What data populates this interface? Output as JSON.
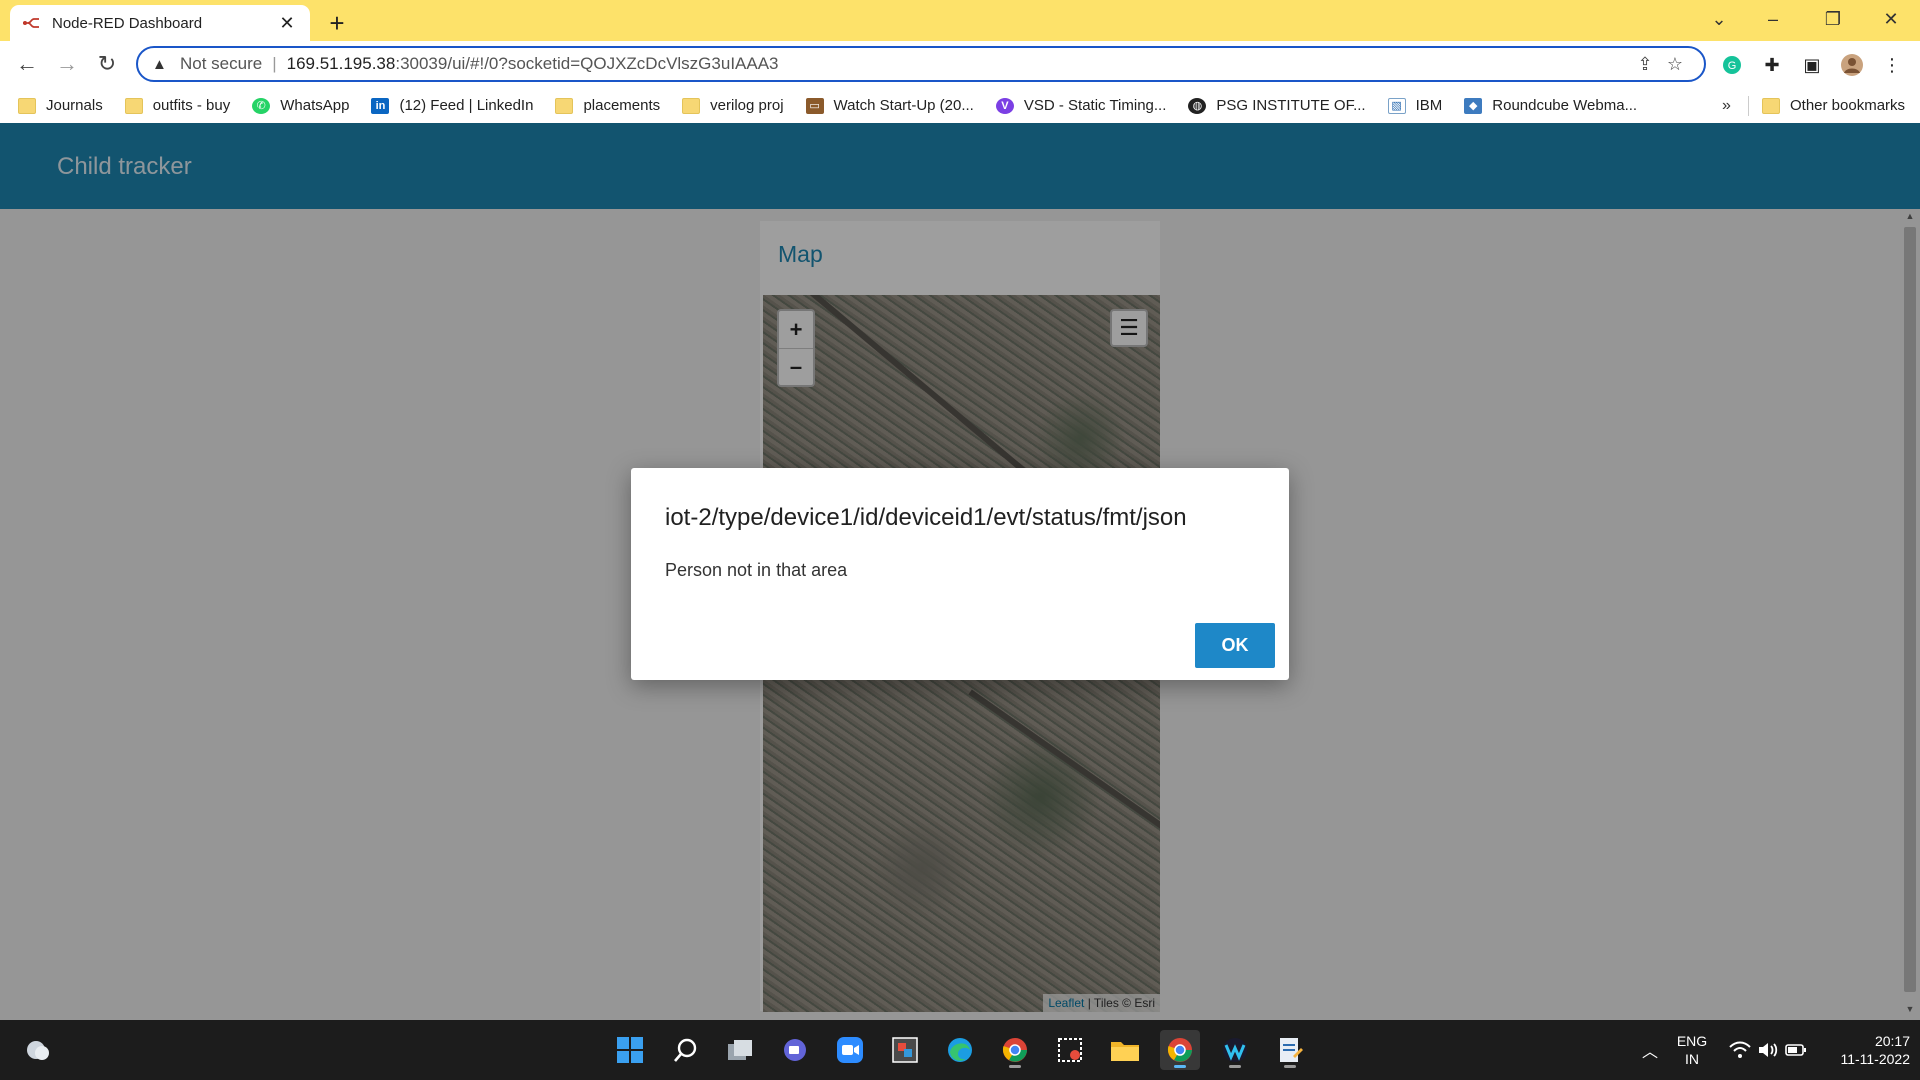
{
  "browser": {
    "tab_title": "Node-RED Dashboard",
    "address": {
      "security_label": "Not secure",
      "url_host": "169.51.195.38",
      "url_rest": ":30039/ui/#!/0?socketid=QOJXZcDcVlszG3uIAAA3"
    },
    "bookmarks": [
      {
        "label": "Journals",
        "icon": "folder-icon"
      },
      {
        "label": "outfits - buy",
        "icon": "folder-icon"
      },
      {
        "label": "WhatsApp",
        "icon": "whatsapp-icon"
      },
      {
        "label": "(12) Feed | LinkedIn",
        "icon": "linkedin-icon"
      },
      {
        "label": "placements",
        "icon": "folder-icon"
      },
      {
        "label": "verilog proj",
        "icon": "folder-icon"
      },
      {
        "label": "Watch Start-Up (20...",
        "icon": "tv-icon"
      },
      {
        "label": "VSD - Static Timing...",
        "icon": "vsd-icon"
      },
      {
        "label": "PSG INSTITUTE OF...",
        "icon": "globe-icon"
      },
      {
        "label": "IBM",
        "icon": "image-icon"
      },
      {
        "label": "Roundcube Webma...",
        "icon": "roundcube-icon"
      }
    ],
    "bookmarks_more": "»",
    "other_bookmarks": "Other bookmarks"
  },
  "dashboard": {
    "title": "Child tracker",
    "group_title": "Map",
    "map": {
      "zoom_in": "+",
      "zoom_out": "–",
      "layers": "☰",
      "attribution_link": "Leaflet",
      "attribution_text": " | Tiles © Esri"
    }
  },
  "dialog": {
    "title": "iot-2/type/device1/id/deviceid1/evt/status/fmt/json",
    "message": "Person not in that area",
    "ok_label": "OK"
  },
  "taskbar": {
    "language_line1": "ENG",
    "language_line2": "IN",
    "time": "20:17",
    "date": "11-11-2022"
  },
  "colors": {
    "tab_strip": "#fde26a",
    "app_bar": "#1e88b4",
    "ok_button": "#1e88c8",
    "omnibox_border": "#1a56c8"
  }
}
